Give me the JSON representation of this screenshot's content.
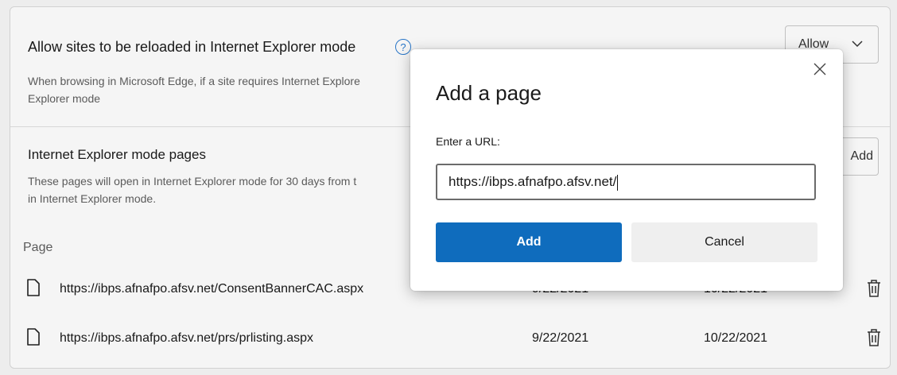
{
  "settings": {
    "ie_reload": {
      "title": "Allow sites to be reloaded in Internet Explorer mode",
      "help_icon": "?",
      "description_line1": "When browsing in Microsoft Edge, if a site requires Internet Explore",
      "description_line2": "Explorer mode",
      "select_value": "Allow"
    },
    "ie_pages": {
      "title": "Internet Explorer mode pages",
      "description_line1": "These pages will open in Internet Explorer mode for 30 days from t",
      "description_line2": "in Internet Explorer mode.",
      "add_label": "Add",
      "column_page": "Page",
      "rows": [
        {
          "url": "https://ibps.afnafpo.afsv.net/ConsentBannerCAC.aspx",
          "date_added": "9/22/2021",
          "expires": "10/22/2021"
        },
        {
          "url": "https://ibps.afnafpo.afsv.net/prs/prlisting.aspx",
          "date_added": "9/22/2021",
          "expires": "10/22/2021"
        }
      ]
    }
  },
  "dialog": {
    "title": "Add a page",
    "field_label": "Enter a URL:",
    "input_value": "https://ibps.afnafpo.afsv.net/",
    "add_label": "Add",
    "cancel_label": "Cancel",
    "close_icon": "close-icon"
  },
  "colors": {
    "accent": "#0f6cbd",
    "help_icon": "#2b7bd0"
  }
}
